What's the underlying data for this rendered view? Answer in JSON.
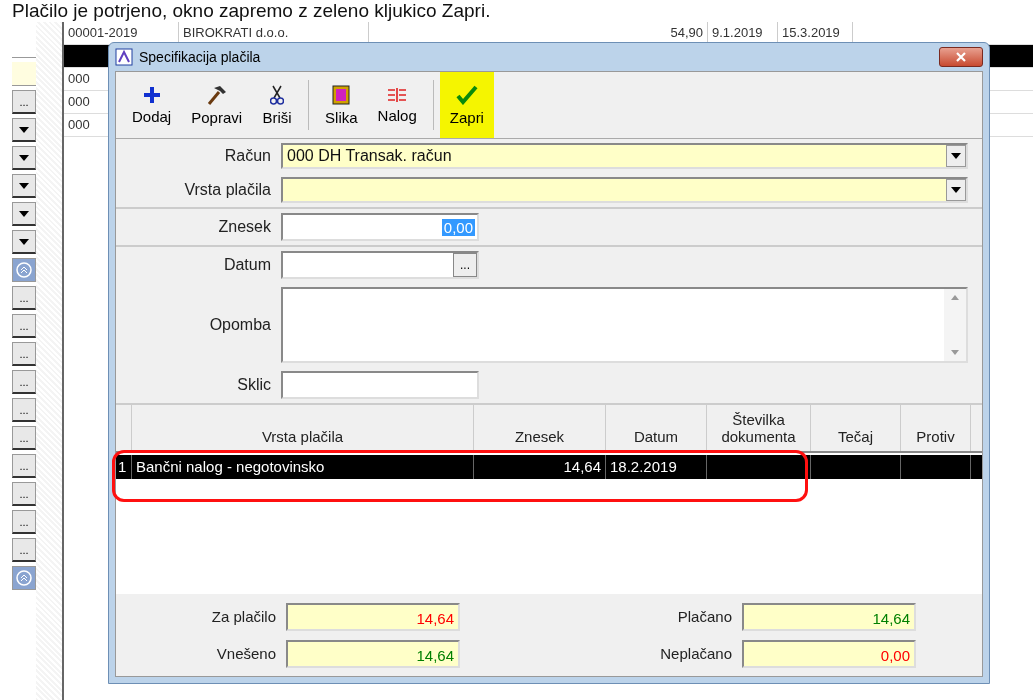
{
  "caption": "Plačilo je potrjeno, okno zapremo z zeleno kljukico Zapri.",
  "side_strip": [
    {
      "kind": "blank"
    },
    {
      "kind": "field"
    },
    {
      "kind": "dots",
      "label": "..."
    },
    {
      "kind": "dropdown"
    },
    {
      "kind": "dropdown"
    },
    {
      "kind": "dropdown"
    },
    {
      "kind": "dropdown"
    },
    {
      "kind": "dropdown"
    },
    {
      "kind": "collapse"
    },
    {
      "kind": "dots",
      "label": "..."
    },
    {
      "kind": "dots",
      "label": "..."
    },
    {
      "kind": "dots",
      "label": "..."
    },
    {
      "kind": "dots",
      "label": "..."
    },
    {
      "kind": "dots",
      "label": "..."
    },
    {
      "kind": "dots",
      "label": "..."
    },
    {
      "kind": "dots",
      "label": "..."
    },
    {
      "kind": "dots",
      "label": "..."
    },
    {
      "kind": "dots",
      "label": "..."
    },
    {
      "kind": "dots",
      "label": "..."
    },
    {
      "kind": "collapse"
    }
  ],
  "background_table": {
    "rows": [
      {
        "selected": false,
        "cells": [
          "00001-2019",
          "BIROKRATI d.o.o.",
          "54,90",
          "9.1.2019",
          "15.3.2019"
        ]
      },
      {
        "selected": true,
        "cells": []
      },
      {
        "selected": false,
        "cells": [
          "000"
        ]
      },
      {
        "selected": false,
        "cells": [
          "000"
        ]
      },
      {
        "selected": false,
        "cells": [
          "000"
        ]
      }
    ]
  },
  "dialog": {
    "title": "Specifikacija plačila",
    "toolbar": [
      {
        "kind": "add",
        "label": "Dodaj",
        "highlighted": false
      },
      {
        "kind": "edit",
        "label": "Popravi",
        "highlighted": false
      },
      {
        "kind": "delete",
        "label": "Briši",
        "highlighted": false
      },
      {
        "kind": "separator"
      },
      {
        "kind": "image",
        "label": "Slika",
        "highlighted": false
      },
      {
        "kind": "order",
        "label": "Nalog",
        "highlighted": false
      },
      {
        "kind": "separator"
      },
      {
        "kind": "close",
        "label": "Zapri",
        "highlighted": true
      }
    ],
    "form": [
      {
        "kind": "combo",
        "label": "Račun",
        "value": "000  DH Transak. račun",
        "section_end": false
      },
      {
        "kind": "combo",
        "label": "Vrsta plačila",
        "section_end": true
      },
      {
        "kind": "amount",
        "label": "Znesek",
        "value": "0,00",
        "section_end": true
      },
      {
        "kind": "date",
        "label": "Datum",
        "button": "...",
        "section_end": false
      },
      {
        "kind": "memo",
        "label": "Opomba",
        "section_end": false
      },
      {
        "kind": "text",
        "label": "Sklic",
        "section_end": false
      }
    ],
    "grid": {
      "columns": [
        "Vrsta plačila",
        "Znesek",
        "Datum",
        "Številka dokumenta",
        "Tečaj",
        "Protiv"
      ],
      "rows": [
        {
          "number": "1",
          "selected": true,
          "marked": true,
          "cells": [
            "Bančni nalog - negotovinsko",
            "14,64",
            "18.2.2019",
            "",
            "",
            ""
          ]
        }
      ]
    },
    "totals": [
      {
        "label": "Za plačilo",
        "value": "14,64",
        "color": "#ff0000"
      },
      {
        "label": "Plačano",
        "value": "14,64",
        "color": "#008000"
      },
      {
        "label": "Vnešeno",
        "value": "14,64",
        "color": "#008000"
      },
      {
        "label": "Neplačano",
        "value": "0,00",
        "color": "#ff0000"
      }
    ]
  }
}
